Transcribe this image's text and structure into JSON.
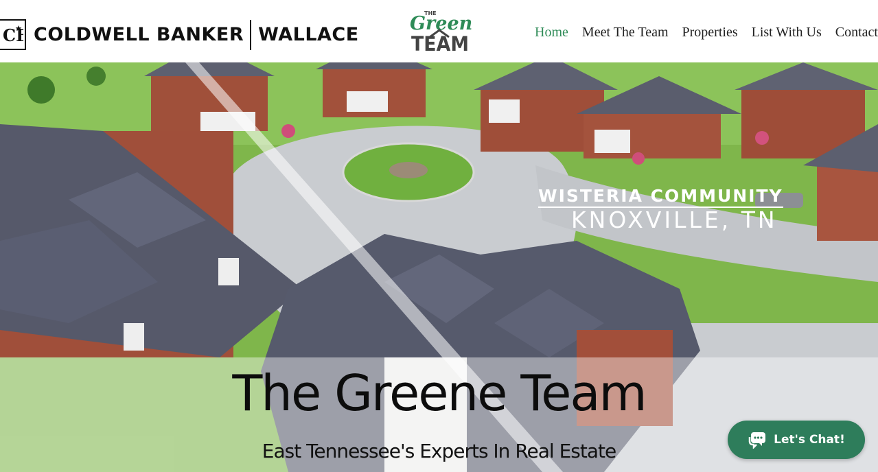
{
  "brand": {
    "cb_mark": "CB",
    "cb_name": "COLDWELL BANKER",
    "cb_office": "WALLACE",
    "team_logo_the": "THE",
    "team_logo_greene": "Greene",
    "team_logo_team": "TEAM"
  },
  "nav": {
    "items": [
      {
        "label": "Home",
        "active": true
      },
      {
        "label": "Meet The Team",
        "active": false
      },
      {
        "label": "Properties",
        "active": false
      },
      {
        "label": "List With Us",
        "active": false
      },
      {
        "label": "Contact",
        "active": false
      }
    ],
    "active_color": "#2e8b57"
  },
  "hero": {
    "video_caption_line1": "WISTERIA COMMUNITY",
    "video_caption_line2": "KNOXVILLE, TN",
    "title": "The Greene Team",
    "subtitle": "East Tennessee's Experts In Real Estate"
  },
  "chat": {
    "label": "Let's Chat!",
    "icon": "chat-bubbles-icon",
    "color": "#2e7d5b"
  }
}
